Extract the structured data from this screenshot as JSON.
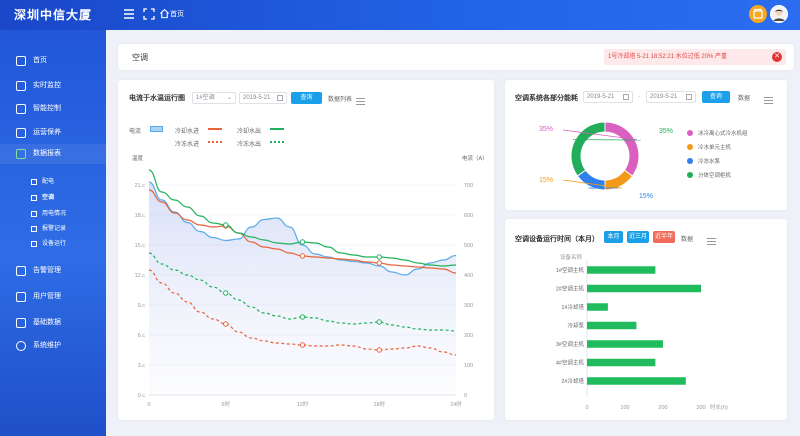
{
  "header": {
    "brand": "深圳中信大厦",
    "breadcrumb": "首页"
  },
  "sidebar": {
    "items": [
      {
        "label": "首页",
        "icon": "chart-icon"
      },
      {
        "label": "实时监控",
        "icon": "grid-icon"
      },
      {
        "label": "智能控制",
        "icon": "sliders-icon"
      },
      {
        "label": "运营保养",
        "icon": "clipboard-icon"
      },
      {
        "label": "数据报表",
        "icon": "line-chart-icon"
      },
      {
        "label": "告警管理",
        "icon": "alert-icon"
      },
      {
        "label": "用户管理",
        "icon": "user-icon"
      },
      {
        "label": "基础数据",
        "icon": "database-icon"
      },
      {
        "label": "系统维护",
        "icon": "gear-icon"
      }
    ],
    "subitems": [
      {
        "label": "配电"
      },
      {
        "label": "空调"
      },
      {
        "label": "用电情况"
      },
      {
        "label": "报警记录"
      },
      {
        "label": "设备运行"
      }
    ]
  },
  "page": {
    "title": "空调",
    "alarm": "1号冷却塔 5-21  18:52:21  水位过低  20%  严重"
  },
  "main_chart": {
    "title": "电流于水温运行图",
    "device_select": "1#空调",
    "date": "2019-5-21",
    "query_label": "查询",
    "list_label": "数据列表",
    "legend": {
      "current": "电流",
      "cw_in": "冷却水进",
      "cw_out": "冷却水出",
      "chw_in": "冷冻水进",
      "chw_out": "冷冻水出"
    },
    "colors": {
      "current": "#5aabea",
      "cw_in": "#e8643c",
      "cw_out": "#20b25c",
      "chw_in": "#e8643c",
      "chw_out": "#20b25c"
    }
  },
  "chart_data": [
    {
      "type": "line",
      "title": "电流于水温运行图",
      "xlabel": "",
      "ylabel": "温度",
      "y2label": "电流（A）",
      "x_ticks": [
        "0",
        "6时",
        "12时",
        "18时",
        "24时"
      ],
      "y_ticks": [
        "0.c",
        "3.c",
        "6.c",
        "9.c",
        "12.c",
        "15.c",
        "18.c",
        "21.c"
      ],
      "y2_ticks": [
        "0",
        "100",
        "200",
        "300",
        "400",
        "500",
        "600",
        "700"
      ],
      "ylim": [
        0,
        21
      ],
      "y2lim": [
        0,
        700
      ],
      "x": [
        0,
        1,
        2,
        3,
        4,
        5,
        6,
        7,
        8,
        9,
        10,
        11,
        12,
        13,
        14,
        15,
        16,
        17,
        18,
        19,
        20,
        21,
        22,
        23,
        24
      ],
      "series": [
        {
          "name": "电流",
          "axis": "y2",
          "values": [
            710,
            650,
            610,
            575,
            545,
            525,
            515,
            520,
            560,
            585,
            590,
            560,
            500,
            470,
            460,
            450,
            445,
            440,
            430,
            410,
            400,
            420,
            440,
            450,
            465
          ]
        },
        {
          "name": "冷却水进",
          "axis": "y",
          "values": [
            20.5,
            19.3,
            18.2,
            17.5,
            17.0,
            16.8,
            16.9,
            16.2,
            15.3,
            14.8,
            14.6,
            14.2,
            13.9,
            13.8,
            13.7,
            13.6,
            13.5,
            13.3,
            13.2,
            13.0,
            12.9,
            12.8,
            12.7,
            12.6,
            12.2
          ]
        },
        {
          "name": "冷却水出",
          "axis": "y",
          "values": [
            22.5,
            20.3,
            19.5,
            18.8,
            17.9,
            17.2,
            17.0,
            16.2,
            15.8,
            15.5,
            15.2,
            15.1,
            15.3,
            15.2,
            14.8,
            14.2,
            14.0,
            13.8,
            13.8,
            13.7,
            13.5,
            13.2,
            13.0,
            12.9,
            13.0
          ]
        },
        {
          "name": "冷冻水进",
          "axis": "y",
          "values": [
            12.5,
            11.2,
            10.2,
            9.3,
            8.3,
            7.6,
            7.1,
            6.3,
            5.7,
            5.4,
            5.2,
            5.1,
            5.0,
            4.9,
            4.9,
            5.0,
            4.9,
            4.6,
            4.5,
            4.6,
            4.7,
            4.9,
            4.7,
            4.3,
            4.0
          ]
        },
        {
          "name": "冷冻水出",
          "axis": "y",
          "values": [
            14.2,
            13.1,
            12.5,
            12.0,
            11.5,
            10.8,
            10.2,
            9.5,
            8.8,
            8.2,
            7.9,
            7.6,
            7.8,
            7.7,
            7.4,
            7.2,
            7.1,
            7.2,
            7.3,
            7.0,
            6.8,
            6.6,
            6.5,
            6.5,
            6.4
          ]
        }
      ]
    },
    {
      "type": "pie",
      "title": "空调系统各部分能耗",
      "date_from": "2019-5-21",
      "date_to": "2019-5-21",
      "query_label": "查询",
      "data_label": "数据",
      "categories": [
        "冰冷离心式冷水机组",
        "冷水单元主机",
        "冷冻水泵",
        "分体空调柜机"
      ],
      "values": [
        35,
        15,
        15,
        35
      ],
      "labels": [
        "35%",
        "15%",
        "15%",
        "35%"
      ],
      "colors": [
        "#d95fc0",
        "#f39a18",
        "#2f80ed",
        "#21ad5a"
      ]
    },
    {
      "type": "bar",
      "orientation": "horizontal",
      "title": "空调设备运行时间（本月）",
      "buttons": [
        "本月",
        "近三月",
        "近半年",
        "数据"
      ],
      "button_colors": [
        "#1a9fe8",
        "#1a9fe8",
        "#f06b5a"
      ],
      "ylabel": "设备名称",
      "xlabel": "时长(h)",
      "categories": [
        "1#空调主机",
        "2#空调主机",
        "1#冷却塔",
        "冷却泵",
        "3#空调主机",
        "4#空调主机",
        "2#冷却塔"
      ],
      "values": [
        180,
        300,
        55,
        130,
        200,
        180,
        260
      ],
      "x_ticks": [
        "0",
        "100",
        "200",
        "300"
      ],
      "xlim": [
        0,
        300
      ],
      "color": "#1fbb5d"
    }
  ]
}
